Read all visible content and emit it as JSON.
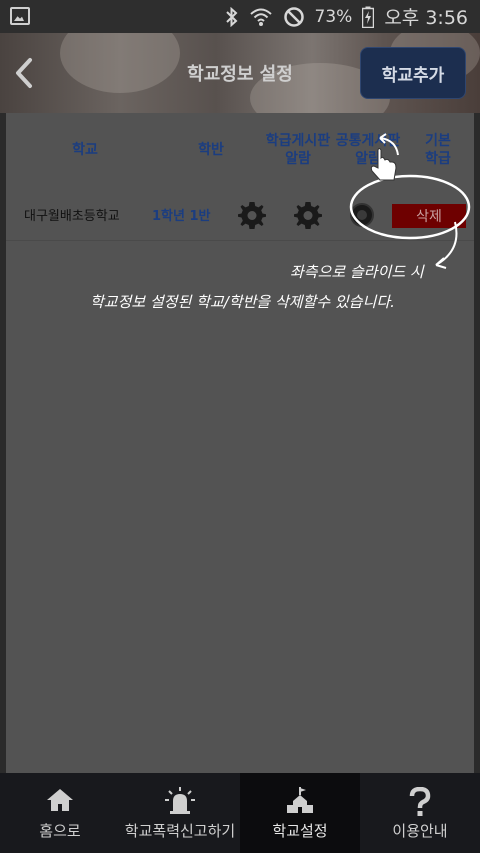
{
  "status_bar": {
    "battery": "73%",
    "time": "오후 3:56",
    "icons": [
      "image-icon",
      "bluetooth-icon",
      "wifi-icon",
      "no-sim-icon",
      "battery-icon"
    ]
  },
  "header": {
    "title": "학교정보 설정",
    "add_button": "학교추가"
  },
  "table": {
    "columns": {
      "school": "학교",
      "class": "학반",
      "board_alarm": [
        "학급게시판",
        "알람"
      ],
      "common_alarm": [
        "공통게시판",
        "알람"
      ],
      "default": [
        "기본",
        "학급"
      ]
    },
    "rows": [
      {
        "school": "대구월배초등학교",
        "class": "1학년 1반",
        "delete": "삭제"
      }
    ]
  },
  "hint": {
    "line1": "좌측으로 슬라이드 시",
    "line2": "학교정보 설정된 학교/학반을 삭제할수 있습니다."
  },
  "tabs": [
    {
      "label": "홈으로",
      "icon": "home-icon"
    },
    {
      "label": "학교폭력신고하기",
      "icon": "siren-icon"
    },
    {
      "label": "학교설정",
      "icon": "school-icon"
    },
    {
      "label": "이용안내",
      "icon": "question-icon"
    }
  ],
  "colors": {
    "header_button": "#1c2e4f",
    "delete_button": "#6e0000",
    "column_text": "#1b3d80"
  }
}
